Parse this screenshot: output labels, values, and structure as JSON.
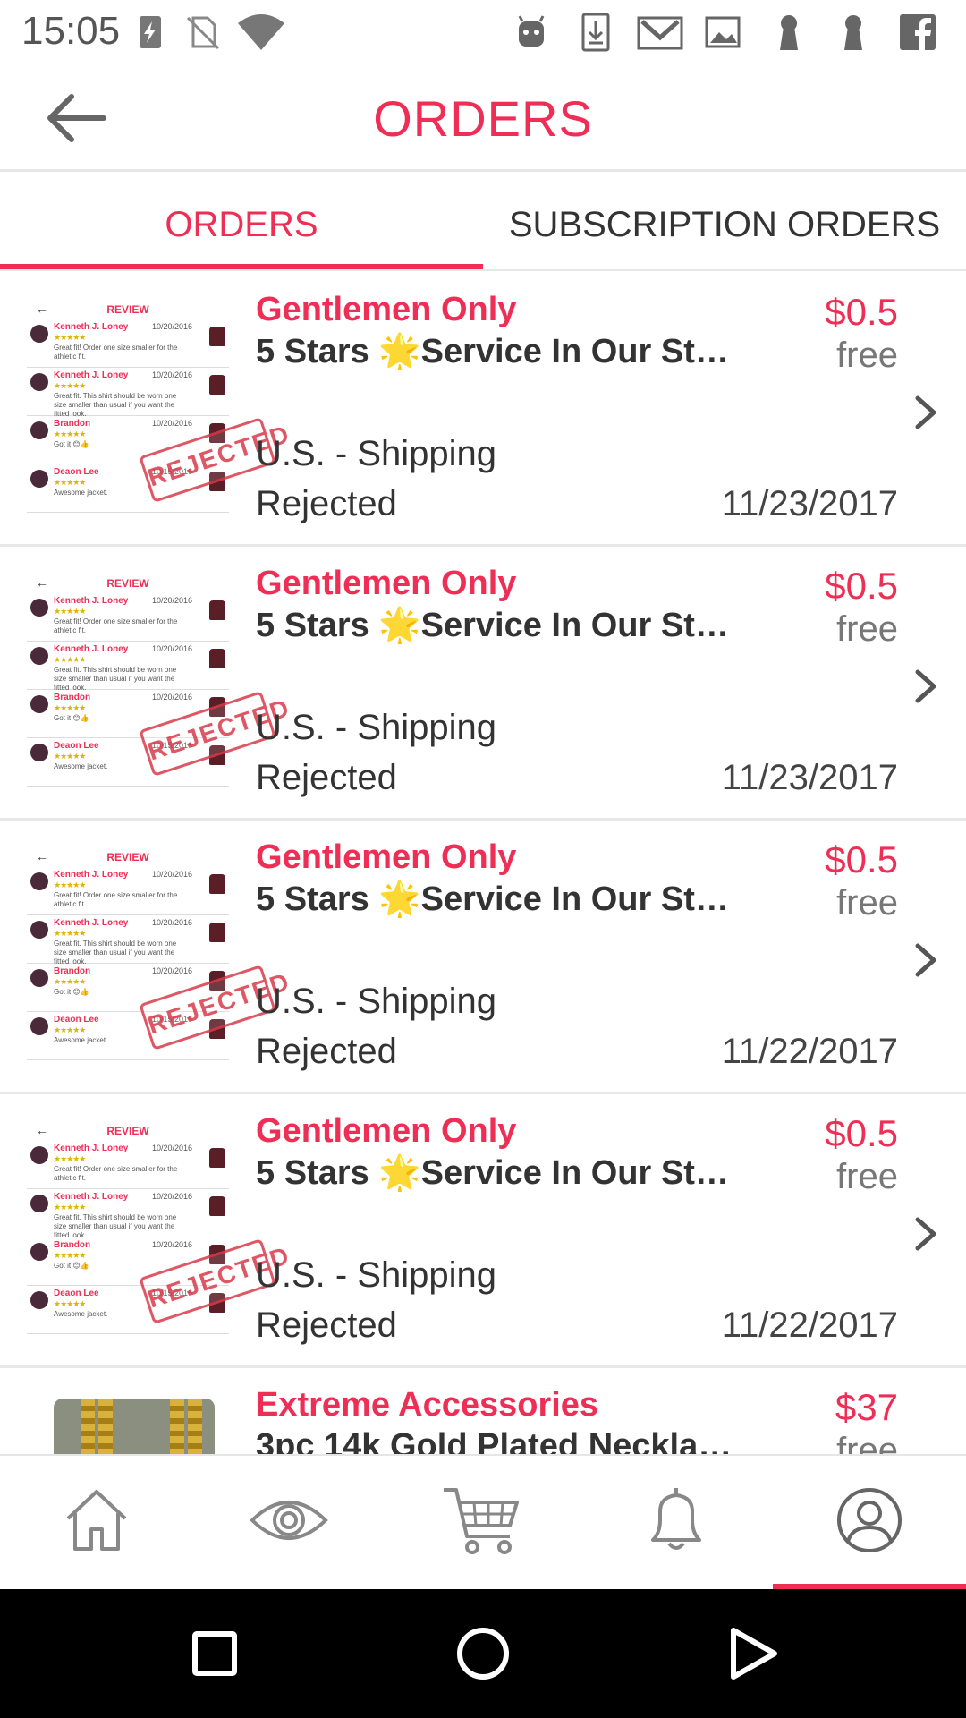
{
  "status_bar": {
    "time": "15:05",
    "icons": [
      "battery-charging-icon",
      "no-sim-icon",
      "wifi-icon",
      "android-icon",
      "download-icon",
      "gmail-icon",
      "image-icon",
      "keyhole-icon",
      "keyhole-icon",
      "facebook-icon"
    ]
  },
  "header": {
    "title": "ORDERS",
    "back_icon": "arrow-left-icon"
  },
  "tabs": [
    {
      "label": "ORDERS",
      "active": true
    },
    {
      "label": "SUBSCRIPTION ORDERS",
      "active": false
    }
  ],
  "thumbnail": {
    "review_title": "REVIEW",
    "back_arrow": "←",
    "stamp": "REJECTED",
    "reviews": [
      {
        "name": "Kenneth J. Loney",
        "date": "10/20/2016",
        "stars": "★★★★★",
        "text": "Great fit! Order one size smaller for the athletic fit."
      },
      {
        "name": "Kenneth J. Loney",
        "date": "10/20/2016",
        "stars": "★★★★★",
        "text": "Great fit. This shirt should be worn one size smaller than usual if you want the fitted look."
      },
      {
        "name": "Brandon",
        "date": "10/20/2016",
        "stars": "★★★★★",
        "text": "Got it 😊👍"
      },
      {
        "name": "Deaon Lee",
        "date": "10/15/2016",
        "stars": "★★★★★",
        "text": "Awesome jacket."
      }
    ]
  },
  "orders": [
    {
      "store": "Gentlemen Only",
      "product": "5 Stars 🌟Service In Our St…",
      "price": "$0.5",
      "price_sub": "free",
      "shipping": "U.S. - Shipping",
      "status": "Rejected",
      "date": "11/23/2017"
    },
    {
      "store": "Gentlemen Only",
      "product": "5 Stars 🌟Service In Our St…",
      "price": "$0.5",
      "price_sub": "free",
      "shipping": "U.S. - Shipping",
      "status": "Rejected",
      "date": "11/23/2017"
    },
    {
      "store": "Gentlemen Only",
      "product": "5 Stars 🌟Service In Our St…",
      "price": "$0.5",
      "price_sub": "free",
      "shipping": "U.S. - Shipping",
      "status": "Rejected",
      "date": "11/22/2017"
    },
    {
      "store": "Gentlemen Only",
      "product": "5 Stars 🌟Service In Our St…",
      "price": "$0.5",
      "price_sub": "free",
      "shipping": "U.S. - Shipping",
      "status": "Rejected",
      "date": "11/22/2017"
    },
    {
      "store": "Extreme Accessories",
      "product": "3pc 14k Gold Plated Neckla…",
      "price": "$37",
      "price_sub": "free",
      "shipping": "",
      "status": "",
      "date": ""
    }
  ],
  "bottom_nav": [
    {
      "name": "home",
      "icon": "home-icon"
    },
    {
      "name": "explore",
      "icon": "eye-icon"
    },
    {
      "name": "cart",
      "icon": "cart-icon"
    },
    {
      "name": "notifications",
      "icon": "bell-icon"
    },
    {
      "name": "profile",
      "icon": "user-icon",
      "active": true
    }
  ],
  "system_nav": [
    "square-recents-icon",
    "circle-home-icon",
    "triangle-back-icon"
  ],
  "colors": {
    "accent": "#ef2e56",
    "text": "#333333",
    "muted": "#777777"
  }
}
